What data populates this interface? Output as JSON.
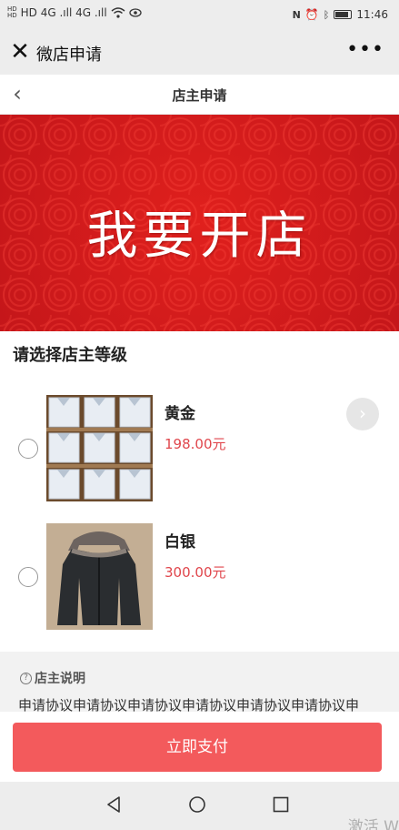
{
  "status_bar": {
    "left_text": "HD 4G .ıll 4G .ıll",
    "time": "11:46",
    "icons": [
      "nfc-icon",
      "alarm-icon",
      "bluetooth-icon",
      "battery-icon"
    ]
  },
  "wechat_bar": {
    "title": "微店申请",
    "more": "•••"
  },
  "page": {
    "title": "店主申请"
  },
  "banner": {
    "text": "我要开店",
    "colors": {
      "red": "#d81e1e",
      "text": "#ffffff"
    }
  },
  "section": {
    "title": "请选择店主等级"
  },
  "tiers": [
    {
      "name": "黄金",
      "price": "198.00元",
      "image": "folded-shirts"
    },
    {
      "name": "白银",
      "price": "300.00元",
      "image": "black-down-jacket"
    }
  ],
  "notes": {
    "title": "店主说明",
    "body": "申请协议申请协议申请协议申请协议申请协议申请协议申"
  },
  "pay": {
    "label": "立即支付",
    "color": "#f35a5c"
  },
  "system_nav": {
    "buttons": [
      "back-icon",
      "home-icon",
      "recents-icon"
    ]
  },
  "watermark": "激活 W"
}
